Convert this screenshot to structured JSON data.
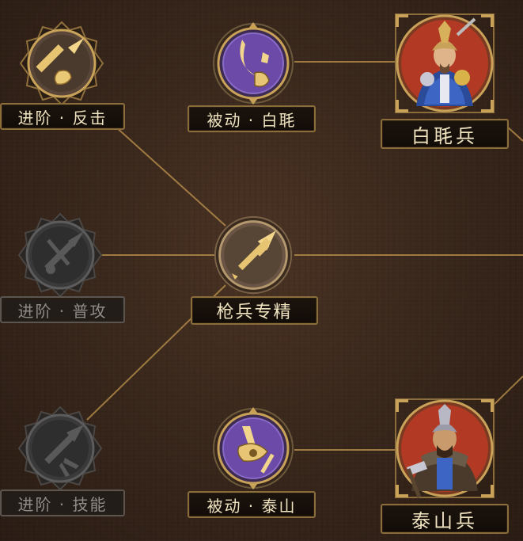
{
  "colors": {
    "gold": "#c9a25a",
    "passive_purple": "#6b4aa8",
    "locked_gray": "#3b3b3b",
    "portrait_red": "#b23a24"
  },
  "nodes": {
    "advance_counter": {
      "label": "进阶 · 反击",
      "icon": "spear-fist-icon",
      "state": "unlocked"
    },
    "passive_baima": {
      "label": "被动 · 白毦",
      "icon": "crescent-blade-icon",
      "state": "passive"
    },
    "unit_baima": {
      "label": "白毦兵",
      "icon": "baima-soldier-portrait"
    },
    "advance_normal": {
      "label": "进阶 · 普攻",
      "icon": "crossed-weapons-icon",
      "state": "locked"
    },
    "spear_mastery": {
      "label": "枪兵专精",
      "icon": "spear-icon",
      "state": "core"
    },
    "advance_skill": {
      "label": "进阶 · 技能",
      "icon": "spear-burst-icon",
      "state": "locked"
    },
    "passive_taishan": {
      "label": "被动 · 泰山",
      "icon": "axe-sword-icon",
      "state": "passive"
    },
    "unit_taishan": {
      "label": "泰山兵",
      "icon": "taishan-soldier-portrait"
    }
  }
}
